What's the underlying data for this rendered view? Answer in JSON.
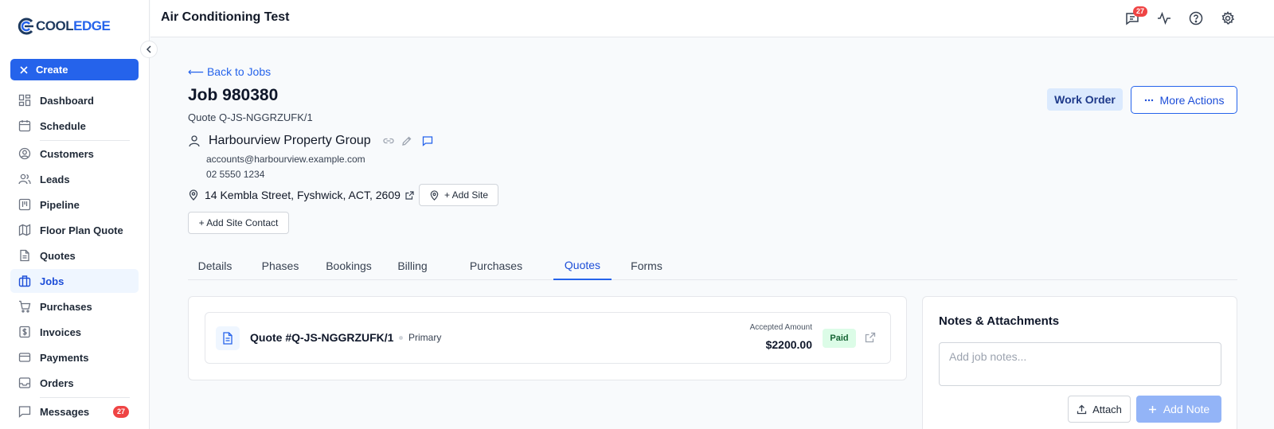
{
  "brand": {
    "logo_primary": "COOL",
    "logo_accent": "EDGE",
    "accent_color": "#2563eb"
  },
  "sidebar": {
    "create_label": "Create",
    "items": [
      {
        "label": "Dashboard",
        "icon": "dashboard-icon"
      },
      {
        "label": "Schedule",
        "icon": "calendar-icon"
      },
      {
        "label": "Customers",
        "icon": "user-circle-icon"
      },
      {
        "label": "Leads",
        "icon": "users-icon"
      },
      {
        "label": "Pipeline",
        "icon": "kanban-icon"
      },
      {
        "label": "Floor Plan Quote",
        "icon": "map-icon"
      },
      {
        "label": "Quotes",
        "icon": "document-icon"
      },
      {
        "label": "Jobs",
        "icon": "briefcase-icon",
        "active": true
      },
      {
        "label": "Purchases",
        "icon": "cart-icon"
      },
      {
        "label": "Invoices",
        "icon": "dollar-file-icon"
      },
      {
        "label": "Payments",
        "icon": "credit-card-icon"
      },
      {
        "label": "Orders",
        "icon": "inbox-icon"
      },
      {
        "label": "Messages",
        "icon": "message-icon",
        "badge": "27"
      }
    ]
  },
  "header": {
    "title": "Air Conditioning Test",
    "notifications_badge": "27"
  },
  "job": {
    "back_label": "⟵ Back to Jobs",
    "title": "Job 980380",
    "quote_ref": "Quote Q-JS-NGGRZUFK/1",
    "client_name": "Harbourview Property Group",
    "email": "accounts@harbourview.example.com",
    "phone": "02 5550 1234",
    "address": "14 Kembla Street, Fyshwick, ACT, 2609",
    "add_site_label": "+ Add Site",
    "add_site_contact_label": "+ Add Site Contact",
    "work_order_label": "Work Order",
    "more_actions_label": "More Actions"
  },
  "tabs": [
    "Details",
    "Phases",
    "Bookings",
    "Billing",
    "Purchases",
    "Quotes",
    "Forms"
  ],
  "active_tab": "Quotes",
  "quote": {
    "number": "Quote #Q-JS-NGGRZUFK/1",
    "tag": "Primary",
    "accepted_label": "Accepted Amount",
    "amount": "$2200.00",
    "status": "Paid"
  },
  "notes": {
    "title": "Notes & Attachments",
    "placeholder": "Add job notes...",
    "attach_label": "Attach",
    "add_note_label": "Add Note"
  }
}
